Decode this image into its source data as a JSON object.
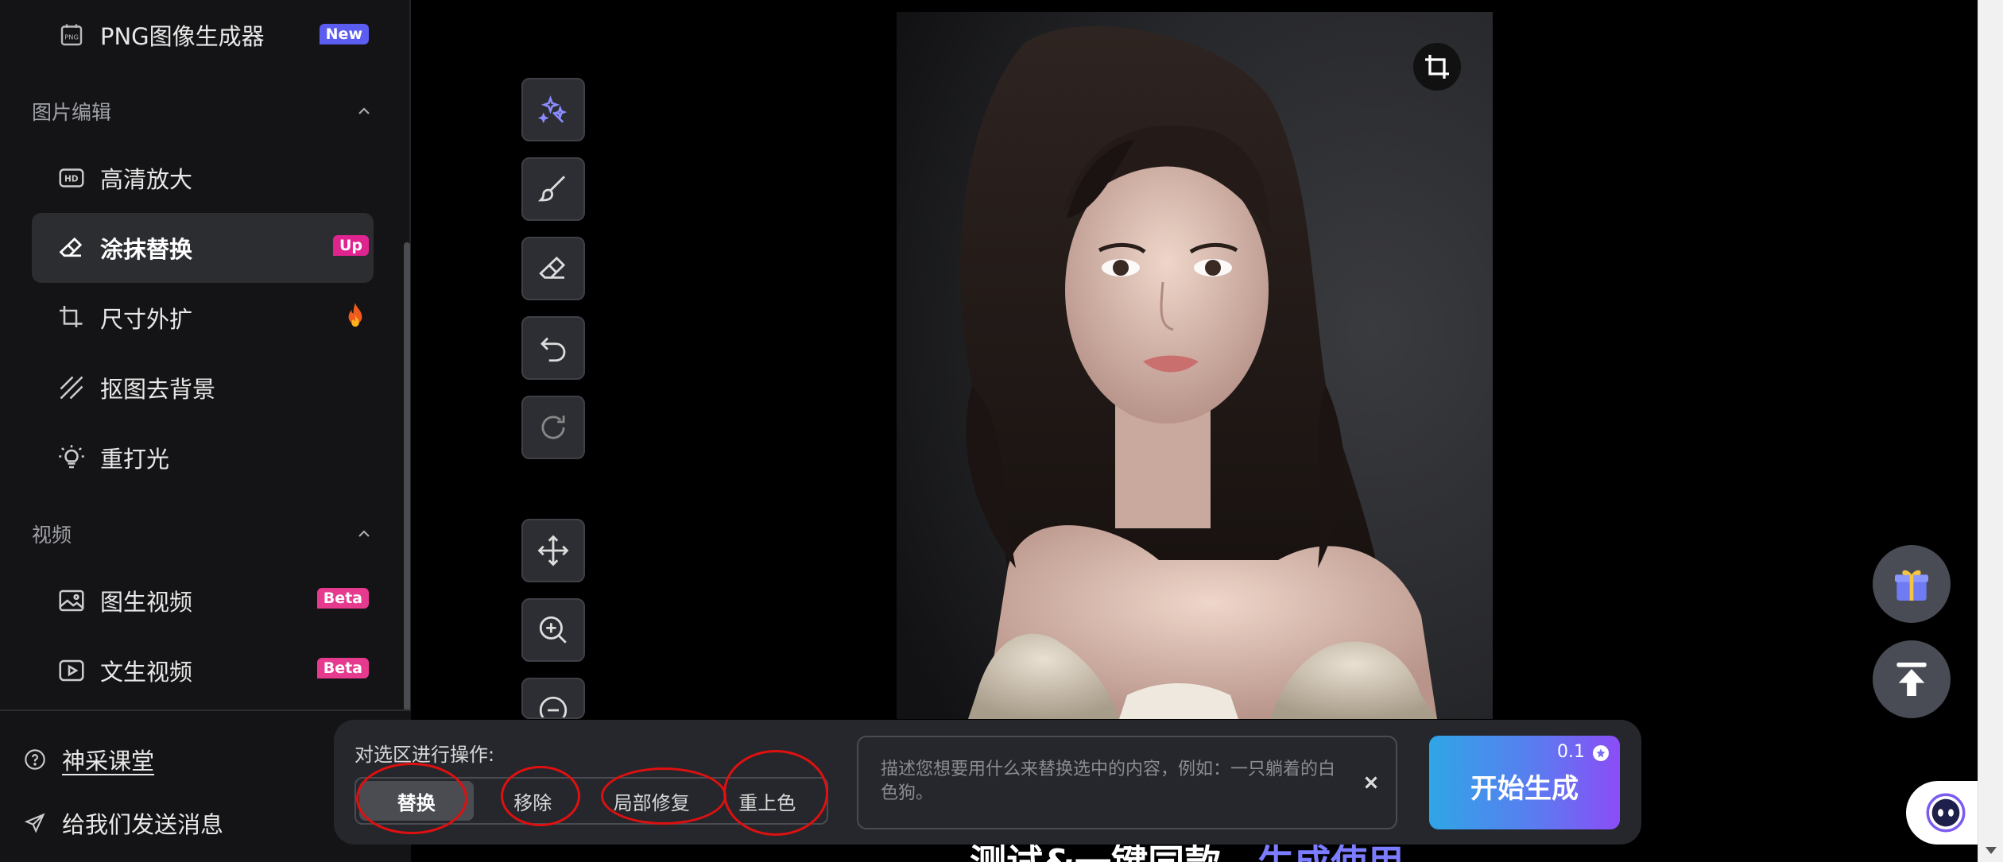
{
  "sidebar": {
    "top_item": {
      "label": "PNG图像生成器",
      "badge": "New"
    },
    "sections": [
      {
        "title": "图片编辑"
      },
      {
        "title": "视频"
      }
    ],
    "image_edit_items": [
      {
        "label": "高清放大",
        "icon": "hd-icon"
      },
      {
        "label": "涂抹替换",
        "icon": "eraser-icon",
        "badge": "Up",
        "active": true
      },
      {
        "label": "尺寸外扩",
        "icon": "crop-expand-icon",
        "hot": true
      },
      {
        "label": "抠图去背景",
        "icon": "stripes-icon"
      },
      {
        "label": "重打光",
        "icon": "lightbulb-icon"
      }
    ],
    "video_items": [
      {
        "label": "图生视频",
        "icon": "image-video-icon",
        "badge": "Beta"
      },
      {
        "label": "文生视频",
        "icon": "play-box-icon",
        "badge": "Beta"
      }
    ],
    "footer": {
      "classroom": "神采课堂",
      "feedback": "给我们发送消息"
    }
  },
  "tools": [
    "magic-wand-icon",
    "brush-icon",
    "eraser-icon",
    "undo-icon",
    "redo-icon",
    "move-icon",
    "zoom-in-icon",
    "zoom-out-icon"
  ],
  "action_bar": {
    "operation_label": "对选区进行操作:",
    "operations": [
      "替换",
      "移除",
      "局部修复",
      "重上色"
    ],
    "selected_operation": "替换",
    "prompt_placeholder": "描述您想要用什么来替换选中的内容，例如：一只躺着的白色狗。",
    "prompt_value": "",
    "generate_label": "开始生成",
    "generate_cost": "0.1"
  },
  "behind_banner": {
    "text": "测试&一键同款",
    "highlight": "生成使用"
  },
  "colors": {
    "accent_purple": "#5b5cf0",
    "badge_pink": "#e0248f",
    "annotation_red": "#e01010",
    "gen_gradient_start": "#2fa6e6",
    "gen_gradient_end": "#8b4df6"
  }
}
